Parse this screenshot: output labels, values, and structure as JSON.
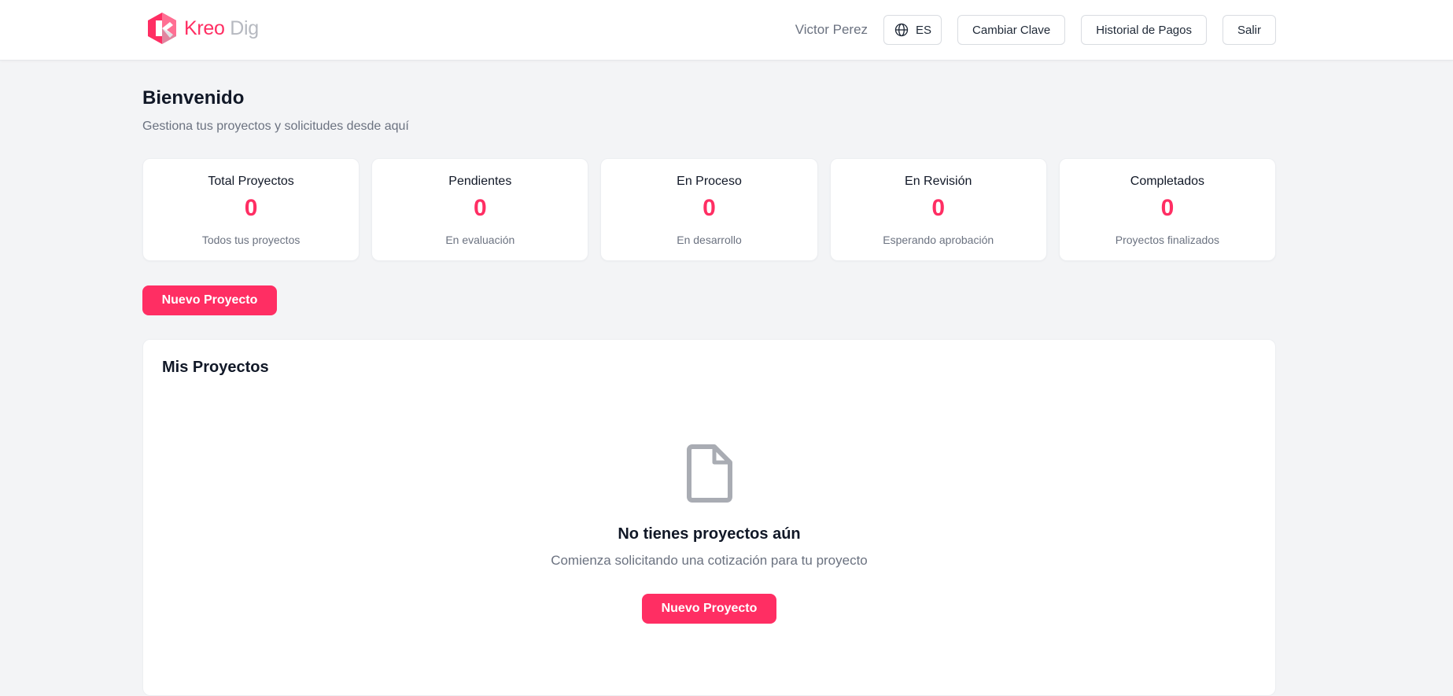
{
  "brand": {
    "name_part1": "Kreo",
    "name_part2": "Dig",
    "accent": "#ff2e63",
    "muted": "#b6b9c0",
    "logo_icon": "kreo-dig-logo"
  },
  "header": {
    "user_name": "Victor Perez",
    "language": {
      "icon": "globe-icon",
      "code": "ES"
    },
    "buttons": {
      "change_password": "Cambiar Clave",
      "payment_history": "Historial de Pagos",
      "logout": "Salir"
    }
  },
  "main": {
    "title": "Bienvenido",
    "subtitle": "Gestiona tus proyectos y solicitudes desde aquí",
    "stats": [
      {
        "title": "Total Proyectos",
        "value": "0",
        "description": "Todos tus proyectos"
      },
      {
        "title": "Pendientes",
        "value": "0",
        "description": "En evaluación"
      },
      {
        "title": "En Proceso",
        "value": "0",
        "description": "En desarrollo"
      },
      {
        "title": "En Revisión",
        "value": "0",
        "description": "Esperando aprobación"
      },
      {
        "title": "Completados",
        "value": "0",
        "description": "Proyectos finalizados"
      }
    ],
    "new_project_label": "Nuevo Proyecto",
    "projects": {
      "title": "Mis Proyectos",
      "empty_icon": "document-icon",
      "empty_title": "No tienes proyectos aún",
      "empty_description": "Comienza solicitando una cotización para tu proyecto",
      "new_project_label": "Nuevo Proyecto"
    }
  }
}
